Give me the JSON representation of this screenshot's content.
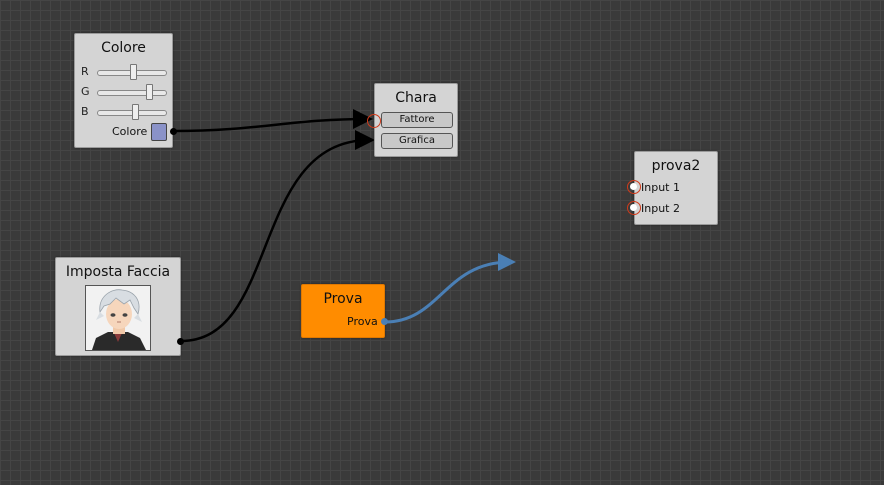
{
  "nodes": {
    "colore": {
      "title": "Colore",
      "sliders": [
        {
          "label": "R",
          "value": 0.52
        },
        {
          "label": "G",
          "value": 0.75
        },
        {
          "label": "B",
          "value": 0.55
        }
      ],
      "output_label": "Colore",
      "swatch_color": "#8a92c8"
    },
    "chara": {
      "title": "Chara",
      "inputs": [
        "Fattore",
        "Grafica"
      ]
    },
    "prova2": {
      "title": "prova2",
      "inputs": [
        "Input 1",
        "Input 2"
      ]
    },
    "imposta_faccia": {
      "title": "Imposta Faccia",
      "portrait_icon": "character-portrait"
    },
    "prova": {
      "title": "Prova",
      "output_label": "Prova",
      "color": "#ff8c00"
    }
  },
  "connection_colors": {
    "default": "#000000",
    "dragging": "#4a7fb5"
  }
}
